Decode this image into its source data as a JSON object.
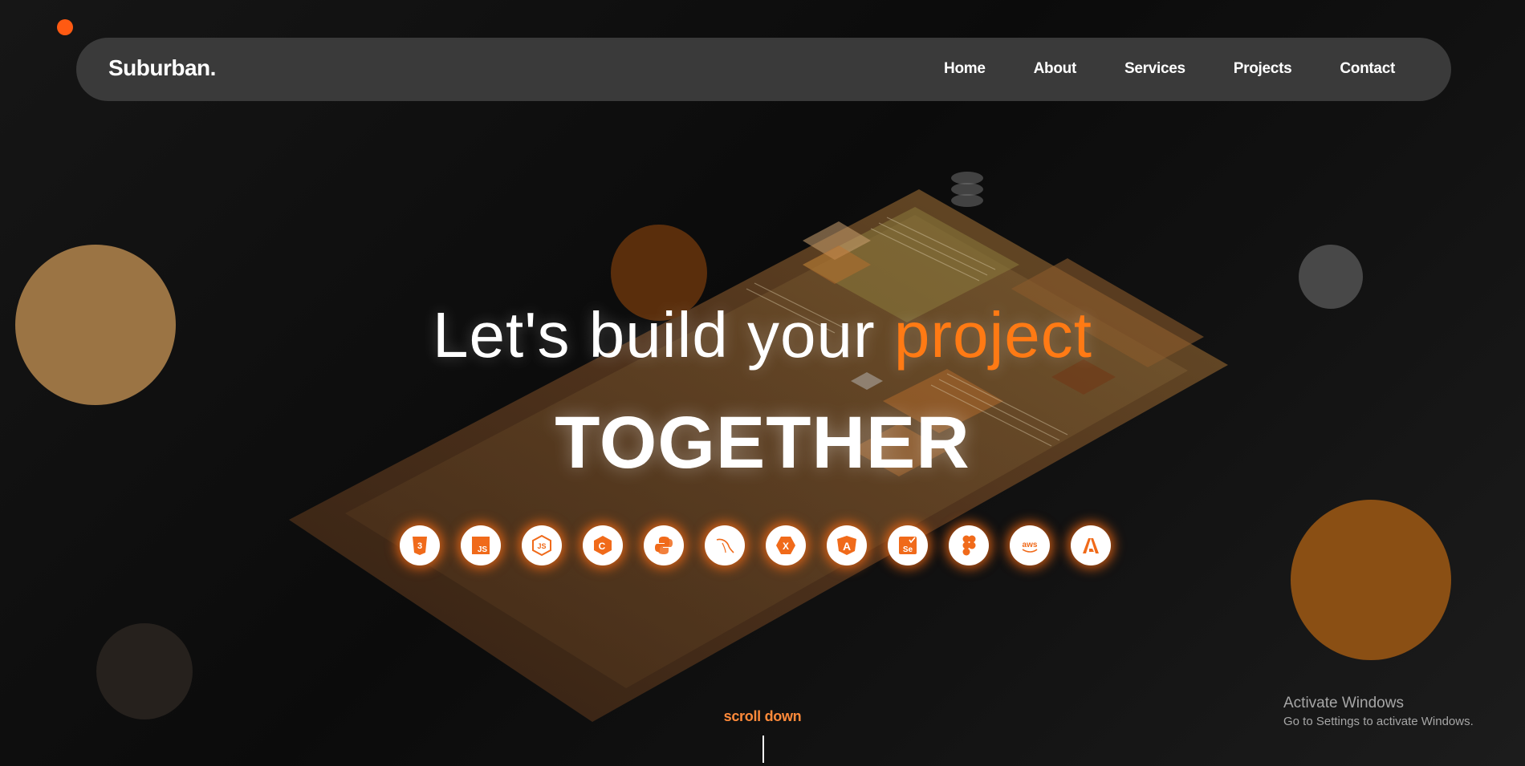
{
  "brand": "Suburban.",
  "nav": [
    "Home",
    "About",
    "Services",
    "Projects",
    "Contact"
  ],
  "hero": {
    "line1_prefix": "Let's build your ",
    "line1_accent": "project",
    "line2": "TOGETHER"
  },
  "tech_icons": [
    {
      "name": "css3-icon",
      "label": "3"
    },
    {
      "name": "javascript-icon",
      "label": "JS"
    },
    {
      "name": "nodejs-icon",
      "label": "JS"
    },
    {
      "name": "csharp-icon",
      "label": "C"
    },
    {
      "name": "python-icon",
      "label": ""
    },
    {
      "name": "mysql-icon",
      "label": ""
    },
    {
      "name": "xamarin-icon",
      "label": "X"
    },
    {
      "name": "angular-icon",
      "label": "A"
    },
    {
      "name": "selenium-icon",
      "label": "Se"
    },
    {
      "name": "figma-icon",
      "label": ""
    },
    {
      "name": "aws-icon",
      "label": "aws"
    },
    {
      "name": "adobe-icon",
      "label": ""
    }
  ],
  "scroll_label": "scroll down",
  "watermark": {
    "title": "Activate Windows",
    "subtitle": "Go to Settings to activate Windows."
  },
  "colors": {
    "accent": "#ff7a14",
    "navbar": "#3a3a3a",
    "background": "#0f0f0f"
  }
}
